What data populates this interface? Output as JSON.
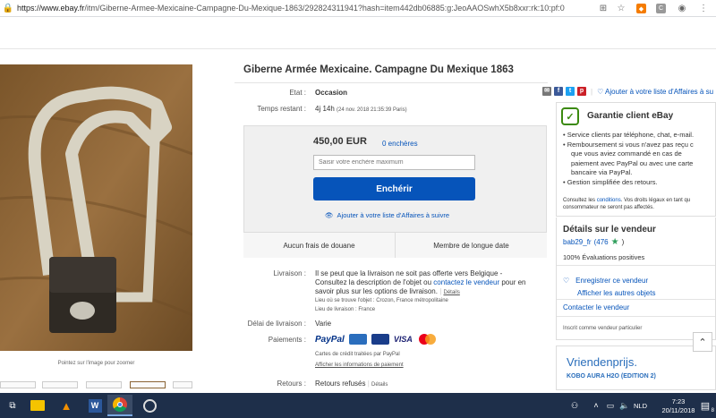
{
  "browser": {
    "url_prefix": "https://www.ebay.fr",
    "url_rest": "/itm/Giberne-Armee-Mexicaine-Campagne-Du-Mexique-1863/292824311941?hash=item442db06885:g:JeoAAOSwhX5b8xxr:rk:10:pf:0"
  },
  "listing": {
    "title": "Giberne Armée Mexicaine. Campagne Du Mexique 1863",
    "photo_hint": "Pointez sur l'image pour zoomer",
    "condition_label": "Etat :",
    "condition_value": "Occasion",
    "time_label": "Temps restant :",
    "time_value": "4j 14h",
    "time_detail": "(24 nov. 2018 21:35:39 Paris)",
    "price": "450,00 EUR",
    "bids": "0 enchères",
    "bid_placeholder": "Saisir votre enchère maximum",
    "bid_button": "Enchérir",
    "watch_link": "Ajouter à votre liste d'Affaires à suivre",
    "cell_customs": "Aucun frais de douane",
    "cell_member": "Membre de longue date",
    "share_watch": "Ajouter à votre liste d'Affaires à su",
    "delivery_label": "Livraison :",
    "delivery_text_1": "Il se peut que la livraison ne soit pas offerte vers Belgique -",
    "delivery_text_2a": "Consultez la description de l'objet ou",
    "delivery_link": "contactez le vendeur",
    "delivery_text_2b": "pour en",
    "delivery_text_3": "savoir plus sur les options de livraison.",
    "delivery_details": "Détails",
    "item_location": "Lieu où se trouve l'objet :  Crozon, France métropolitaine",
    "ship_to": "Lieu de livraison :  France",
    "handling_label": "Délai de livraison :",
    "handling_value": "Varie",
    "payments_label": "Paiements :",
    "paypal": "PayPal",
    "visa": "VISA",
    "cards_note": "Cartes de crédit traitées par PayPal",
    "payment_info_link": "Afficher les informations de paiement",
    "returns_label": "Retours :",
    "returns_value": "Retours refusés",
    "returns_details": "Détails"
  },
  "guarantee": {
    "title": "Garantie client eBay",
    "bullet_1a": "Service clients par téléphone, chat, e-mail.",
    "bullet_2a": "Remboursement si vous n'avez pas reçu c",
    "bullet_2b": "que vous aviez commandé en cas de",
    "bullet_2c": "paiement avec PayPal ou avec une carte",
    "bullet_2d": "bancaire via PayPal.",
    "bullet_3": "Gestion simplifiée des retours.",
    "conditions_a": "Consultez les",
    "conditions_link": "conditions",
    "conditions_b": ". Vos droits légaux en tant qu",
    "conditions_c": "consommateur ne seront pas affectés."
  },
  "seller": {
    "title": "Détails sur le vendeur",
    "name": "bab29_fr",
    "score": "(476",
    "score_close": ")",
    "positive": "100% Évaluations positives",
    "save_seller": "Enregistrer ce vendeur",
    "other_items": "Afficher les autres objets",
    "contact": "Contacter le vendeur",
    "registered": "Inscrit comme vendeur particulier"
  },
  "ad": {
    "title": "Vriendenprijs.",
    "subtitle": "KOBO AURA H2O (EDITION 2)"
  },
  "taskbar": {
    "lang": "NLD",
    "time": "7:23",
    "date": "20/11/2018",
    "notifications": "8"
  },
  "colors": {
    "link": "#0654ba",
    "button": "#0654ba",
    "guarantee_green": "#3b8a0f",
    "taskbar": "#1e2f4a"
  }
}
